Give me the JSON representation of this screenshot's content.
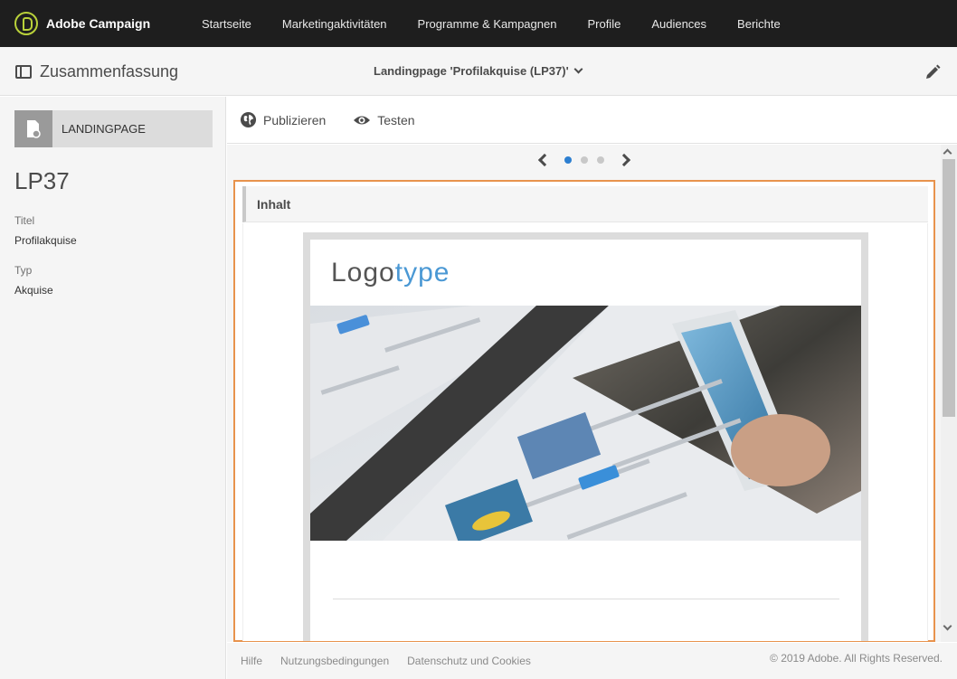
{
  "app": {
    "name": "Adobe Campaign"
  },
  "nav": {
    "items": [
      {
        "label": "Startseite"
      },
      {
        "label": "Marketingaktivitäten"
      },
      {
        "label": "Programme & Kampagnen"
      },
      {
        "label": "Profile"
      },
      {
        "label": "Audiences"
      },
      {
        "label": "Berichte"
      }
    ]
  },
  "header": {
    "summary_label": "Zusammenfassung",
    "page_title": "Landingpage 'Profilakquise (LP37)'"
  },
  "sidebar": {
    "card_label": "LANDINGPAGE",
    "id": "LP37",
    "fields": [
      {
        "label": "Titel",
        "value": "Profilakquise"
      },
      {
        "label": "Typ",
        "value": "Akquise"
      }
    ]
  },
  "toolbar": {
    "publish_label": "Publizieren",
    "test_label": "Testen"
  },
  "pager": {
    "total": 3,
    "current": 1
  },
  "content": {
    "section_label": "Inhalt",
    "logo_dark": "Logo",
    "logo_light": "type"
  },
  "footer": {
    "links": [
      "Hilfe",
      "Nutzungsbedingungen",
      "Datenschutz und Cookies"
    ],
    "copyright": "© 2019 Adobe. All Rights Reserved."
  },
  "colors": {
    "accent_frame": "#e8934d",
    "active_dot": "#2d7fd1",
    "logo_accent": "#b9d13a"
  }
}
